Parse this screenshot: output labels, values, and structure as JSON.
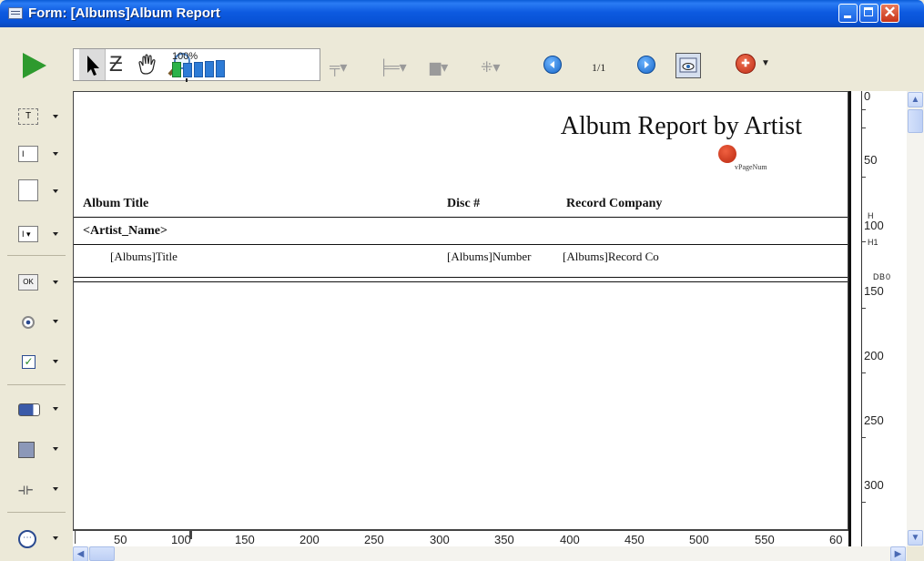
{
  "window": {
    "title": "Form: [Albums]Album Report"
  },
  "toolbar": {
    "zoom_level": "100%",
    "page_indicator": "1/1",
    "tools": [
      "run-icon",
      "arrow-pointer-icon",
      "entry-order-icon",
      "hand-scroll-icon",
      "magnifier-icon",
      "zoom-bar-icon"
    ],
    "layout_tools": [
      "align-icon",
      "distribute-icon",
      "level-icon",
      "grid-icon"
    ],
    "preview": "preview-icon",
    "help": "help-icon"
  },
  "palette": {
    "items": [
      "text-tool-icon",
      "field-tool-icon",
      "list-tool-icon",
      "combo-tool-icon",
      "button-tool-icon",
      "radio-tool-icon",
      "checkbox-tool-icon",
      "progress-tool-icon",
      "rectangle-tool-icon",
      "splitter-tool-icon",
      "plugin-tool-icon"
    ]
  },
  "report": {
    "title": "Album Report by Artist",
    "page_num_var": "vPageNum",
    "headers": {
      "album_title": "Album Title",
      "disc": "Disc #",
      "record_company": "Record Company"
    },
    "group_label": "<Artist_Name>",
    "fields": {
      "title": "[Albums]Title",
      "number": "[Albums]Number",
      "record_co": "[Albums]Record Co"
    }
  },
  "ruler_h": [
    "50",
    "100",
    "150",
    "200",
    "250",
    "300",
    "350",
    "400",
    "450",
    "500",
    "550",
    "60"
  ],
  "ruler_v": {
    "labels": [
      "0",
      "50",
      "100",
      "150",
      "200",
      "250",
      "300"
    ],
    "markers": {
      "h": "H",
      "h1": "H1",
      "d": "D",
      "b": "B",
      "b0": "0"
    }
  },
  "colors": {
    "titlebar": "#0a5bd7",
    "close_button": "#d8482a",
    "zoom_active": "#2bb34a",
    "zoom_bar": "#2d7bd6"
  }
}
